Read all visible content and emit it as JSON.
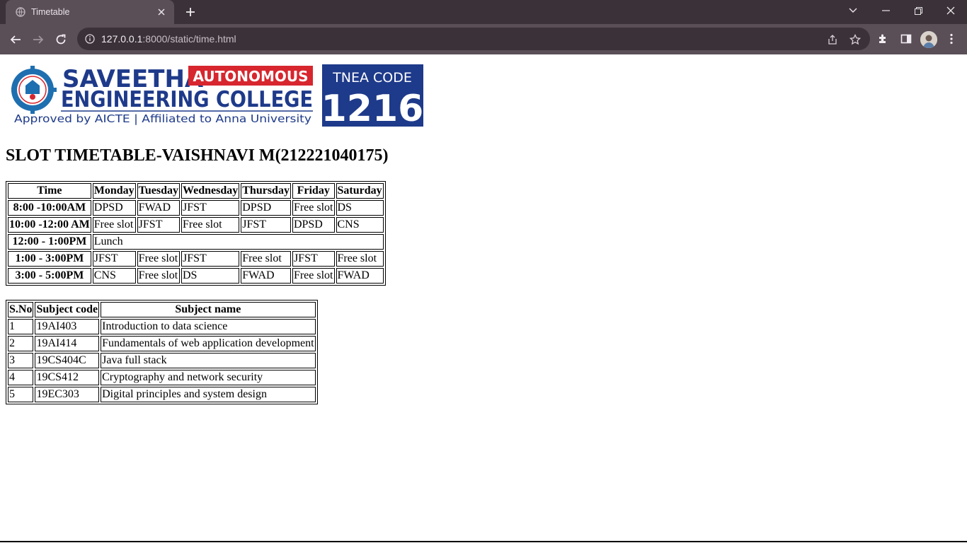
{
  "browser": {
    "tab_title": "Timetable",
    "url_host": "127.0.0.1",
    "url_rest": ":8000/static/time.html"
  },
  "logo": {
    "name_line1": "SAVEETHA",
    "badge": "AUTONOMOUS",
    "name_line2": "ENGINEERING COLLEGE",
    "tagline": "Approved by AICTE  |  Affiliated to Anna University",
    "tnea_label": "TNEA CODE",
    "tnea_code": "1216",
    "brand_color": "#1e3a8a",
    "badge_color": "#d7262e"
  },
  "heading": "SLOT TIMETABLE-VAISHNAVI M(212221040175)",
  "timetable": {
    "headers": [
      "Time",
      "Monday",
      "Tuesday",
      "Wednesday",
      "Thursday",
      "Friday",
      "Saturday"
    ],
    "rows": [
      {
        "time": "8:00 -10:00AM",
        "cells": [
          "DPSD",
          "FWAD",
          "JFST",
          "DPSD",
          "Free slot",
          "DS"
        ]
      },
      {
        "time": "10:00 -12:00 AM",
        "cells": [
          "Free slot",
          "JFST",
          "Free slot",
          "JFST",
          "DPSD",
          "CNS"
        ]
      },
      {
        "time": "12:00 - 1:00PM",
        "lunch": "Lunch"
      },
      {
        "time": "1:00 - 3:00PM",
        "cells": [
          "JFST",
          "Free slot",
          "JFST",
          "Free slot",
          "JFST",
          "Free slot"
        ]
      },
      {
        "time": "3:00 - 5:00PM",
        "cells": [
          "CNS",
          "Free slot",
          "DS",
          "FWAD",
          "Free slot",
          "FWAD"
        ]
      }
    ]
  },
  "subjects": {
    "headers": [
      "S.No",
      "Subject code",
      "Subject name"
    ],
    "rows": [
      [
        "1",
        "19AI403",
        "Introduction to data science"
      ],
      [
        "2",
        "19AI414",
        "Fundamentals of web application development"
      ],
      [
        "3",
        "19CS404C",
        "Java full stack"
      ],
      [
        "4",
        "19CS412",
        "Cryptography and network security"
      ],
      [
        "5",
        "19EC303",
        "Digital principles and system design"
      ]
    ]
  }
}
